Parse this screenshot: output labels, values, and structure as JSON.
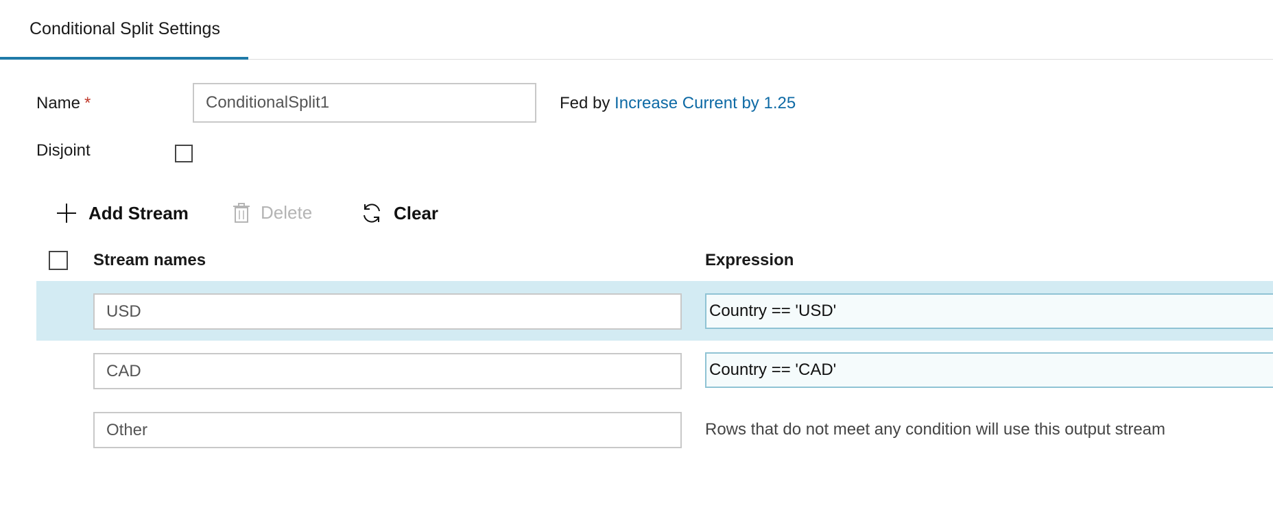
{
  "tab": {
    "label": "Conditional Split Settings"
  },
  "form": {
    "name_label": "Name",
    "required_marker": "*",
    "name_value": "ConditionalSplit1",
    "fed_by_label": "Fed by",
    "fed_by_link": "Increase Current by 1.25",
    "disjoint_label": "Disjoint",
    "disjoint_checked": false
  },
  "toolbar": {
    "add_label": "Add Stream",
    "delete_label": "Delete",
    "clear_label": "Clear"
  },
  "table": {
    "headers": {
      "stream_names": "Stream names",
      "expression": "Expression"
    },
    "rows": [
      {
        "stream": "USD",
        "expression": "Country == 'USD'",
        "selected": true
      },
      {
        "stream": "CAD",
        "expression": "Country == 'CAD'",
        "selected": false
      },
      {
        "stream": "Other",
        "note": "Rows that do not meet any condition will use this output stream"
      }
    ]
  },
  "colors": {
    "accent": "#1f7aa8",
    "link": "#0e6aa5",
    "row_selected": "#d3ebf3",
    "required": "#c0392b"
  }
}
